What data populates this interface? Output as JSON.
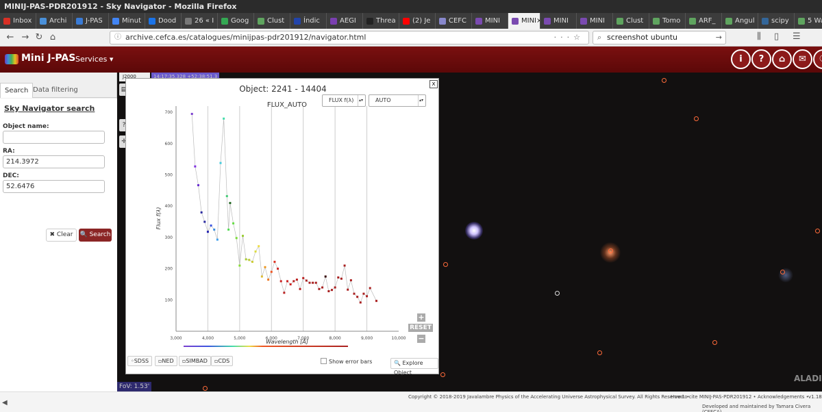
{
  "window": {
    "title": "MINIJ-PAS-PDR201912 - Sky Navigator - Mozilla Firefox"
  },
  "browser": {
    "tabs": [
      {
        "label": "Inbox",
        "color": "#d93025"
      },
      {
        "label": "Archi",
        "color": "#4a90d9"
      },
      {
        "label": "J-PAS",
        "color": "#3a7bd5"
      },
      {
        "label": "Minut",
        "color": "#4285f4"
      },
      {
        "label": "Dood",
        "color": "#1a73e8"
      },
      {
        "label": "26 « I",
        "color": "#777777"
      },
      {
        "label": "Goog",
        "color": "#34a853"
      },
      {
        "label": "Clust",
        "color": "#5fa45f"
      },
      {
        "label": "Índic",
        "color": "#2244aa"
      },
      {
        "label": "AEGI",
        "color": "#7a3fb0"
      },
      {
        "label": "Threa",
        "color": "#222222"
      },
      {
        "label": "(2) Je",
        "color": "#ff0000"
      },
      {
        "label": "CEFC",
        "color": "#8888cc"
      },
      {
        "label": "MINI",
        "color": "#7a4ab0"
      },
      {
        "label": "MINI",
        "color": "#7a4ab0",
        "active": true
      },
      {
        "label": "MINI",
        "color": "#7a4ab0"
      },
      {
        "label": "MINI",
        "color": "#7a4ab0"
      },
      {
        "label": "Clust",
        "color": "#5fa45f"
      },
      {
        "label": "Tomo",
        "color": "#5fa45f"
      },
      {
        "label": "ARF_",
        "color": "#5fa45f"
      },
      {
        "label": "Angul",
        "color": "#5fa45f"
      },
      {
        "label": "scipy",
        "color": "#336699"
      },
      {
        "label": "5 Wa",
        "color": "#5fa45f"
      }
    ],
    "active_tab_close": "×",
    "url": "archive.cefca.es/catalogues/minijpas-pdr201912/navigator.html",
    "search": "screenshot ubuntu"
  },
  "header": {
    "logo": "Mini J-PAS",
    "services": "Services ▾",
    "buttons": [
      "i",
      "?",
      "⌂",
      "✉",
      "☉"
    ]
  },
  "sidebar": {
    "tab_search": "Search",
    "tab_filter": "Data filtering",
    "panel_title": "Sky Navigator search",
    "object_name_label": "Object name:",
    "object_name_value": "",
    "ra_label": "RA:",
    "ra_value": "214.3972",
    "dec_label": "DEC:",
    "dec_value": "52.6476",
    "clear": "✖ Clear",
    "search": "🔍 Search"
  },
  "sky": {
    "coord_system": "J2000",
    "coord_readout": "14:17:35.328 +52:38:51.3",
    "fov": "FoV: 1.53'",
    "watermark": "ALADIN"
  },
  "dialog": {
    "title": "Object: 2241 - 14404",
    "close": "x",
    "plot_title": "FLUX_AUTO",
    "select1": "FLUX f(λ)",
    "select2": "AUTO",
    "reset": "RESET",
    "zoom_in": "+",
    "zoom_out": "−",
    "ext_buttons": [
      "SDSS",
      "NED",
      "SIMBAD",
      "CDS"
    ],
    "error_bars_label": "Show error bars",
    "explore_button": "🔍 Explore Object"
  },
  "chart_data": {
    "type": "scatter",
    "title": "FLUX_AUTO",
    "xlabel": "Wavelength [Å]",
    "ylabel": "Flux f(λ)",
    "xlim": [
      3000,
      10000
    ],
    "ylim": [
      0,
      720
    ],
    "xticks": [
      "3,000",
      "4,000",
      "5,000",
      "6,000",
      "7,000",
      "8,000",
      "9,000",
      "10,000"
    ],
    "yticks": [
      "100",
      "200",
      "300",
      "400",
      "500",
      "600",
      "700"
    ],
    "points": [
      {
        "x": 3500,
        "y": 695,
        "c": "#7b3fcf"
      },
      {
        "x": 3600,
        "y": 527,
        "c": "#7f30e0"
      },
      {
        "x": 3700,
        "y": 467,
        "c": "#6a2fd0"
      },
      {
        "x": 3800,
        "y": 380,
        "c": "#2a2aa0"
      },
      {
        "x": 3900,
        "y": 350,
        "c": "#2a2aa0"
      },
      {
        "x": 4000,
        "y": 318,
        "c": "#2020b0"
      },
      {
        "x": 4100,
        "y": 338,
        "c": "#3b55e0"
      },
      {
        "x": 4200,
        "y": 325,
        "c": "#3b8de0"
      },
      {
        "x": 4300,
        "y": 293,
        "c": "#40a0ee"
      },
      {
        "x": 4400,
        "y": 538,
        "c": "#44ccdd"
      },
      {
        "x": 4500,
        "y": 680,
        "c": "#44ddaa"
      },
      {
        "x": 4600,
        "y": 432,
        "c": "#44cc77"
      },
      {
        "x": 4700,
        "y": 410,
        "c": "#226622"
      },
      {
        "x": 4650,
        "y": 325,
        "c": "#55dd55"
      },
      {
        "x": 4800,
        "y": 345,
        "c": "#66dd44"
      },
      {
        "x": 4900,
        "y": 298,
        "c": "#77dd33"
      },
      {
        "x": 5000,
        "y": 210,
        "c": "#88dd33"
      },
      {
        "x": 5100,
        "y": 305,
        "c": "#99cc33"
      },
      {
        "x": 5200,
        "y": 230,
        "c": "#aacc33"
      },
      {
        "x": 5300,
        "y": 228,
        "c": "#bbcc33"
      },
      {
        "x": 5400,
        "y": 222,
        "c": "#cccc33"
      },
      {
        "x": 5500,
        "y": 255,
        "c": "#dddd44"
      },
      {
        "x": 5600,
        "y": 272,
        "c": "#eedd44"
      },
      {
        "x": 5700,
        "y": 175,
        "c": "#ddbb33"
      },
      {
        "x": 5800,
        "y": 205,
        "c": "#ee9922"
      },
      {
        "x": 5900,
        "y": 165,
        "c": "#ee7722"
      },
      {
        "x": 6000,
        "y": 190,
        "c": "#ee5522"
      },
      {
        "x": 6100,
        "y": 222,
        "c": "#dd3322"
      },
      {
        "x": 6200,
        "y": 200,
        "c": "#cc2222"
      },
      {
        "x": 6300,
        "y": 160,
        "c": "#cc2222"
      },
      {
        "x": 6400,
        "y": 123,
        "c": "#bb2222"
      },
      {
        "x": 6500,
        "y": 160,
        "c": "#cc2222"
      },
      {
        "x": 6600,
        "y": 150,
        "c": "#cc2222"
      },
      {
        "x": 6700,
        "y": 160,
        "c": "#bb2020"
      },
      {
        "x": 6800,
        "y": 165,
        "c": "#bb2020"
      },
      {
        "x": 6900,
        "y": 135,
        "c": "#bb2020"
      },
      {
        "x": 7000,
        "y": 170,
        "c": "#bb2020"
      },
      {
        "x": 7100,
        "y": 162,
        "c": "#aa2020"
      },
      {
        "x": 7200,
        "y": 155,
        "c": "#aa2020"
      },
      {
        "x": 7300,
        "y": 155,
        "c": "#aa2020"
      },
      {
        "x": 7400,
        "y": 155,
        "c": "#aa2020"
      },
      {
        "x": 7500,
        "y": 135,
        "c": "#aa2020"
      },
      {
        "x": 7600,
        "y": 140,
        "c": "#aa2020"
      },
      {
        "x": 7700,
        "y": 175,
        "c": "#330000"
      },
      {
        "x": 7800,
        "y": 128,
        "c": "#aa2020"
      },
      {
        "x": 7900,
        "y": 132,
        "c": "#aa2020"
      },
      {
        "x": 8000,
        "y": 140,
        "c": "#aa2020"
      },
      {
        "x": 8100,
        "y": 172,
        "c": "#aa2020"
      },
      {
        "x": 8200,
        "y": 168,
        "c": "#aa2020"
      },
      {
        "x": 8300,
        "y": 210,
        "c": "#aa2020"
      },
      {
        "x": 8400,
        "y": 133,
        "c": "#aa2020"
      },
      {
        "x": 8500,
        "y": 163,
        "c": "#aa2020"
      },
      {
        "x": 8600,
        "y": 120,
        "c": "#aa2020"
      },
      {
        "x": 8700,
        "y": 110,
        "c": "#aa2020"
      },
      {
        "x": 8800,
        "y": 92,
        "c": "#aa2020"
      },
      {
        "x": 8900,
        "y": 120,
        "c": "#aa2020"
      },
      {
        "x": 9000,
        "y": 112,
        "c": "#aa2020"
      },
      {
        "x": 9100,
        "y": 138,
        "c": "#aa2020"
      },
      {
        "x": 9300,
        "y": 97,
        "c": "#aa2020"
      }
    ]
  },
  "footer": {
    "copyright": "Copyright © 2018-2019 Javalambre Physics of the Accelerating Universe Astrophysical Survey. All Rights Reserved.  •",
    "cite": "How to cite MINIJ-PAS-PDR201912  •",
    "ack": "Acknowledgements  •",
    "version": "v1.18",
    "maintained": "Developed and maintained by Tamara Civera (CEFCA)"
  }
}
